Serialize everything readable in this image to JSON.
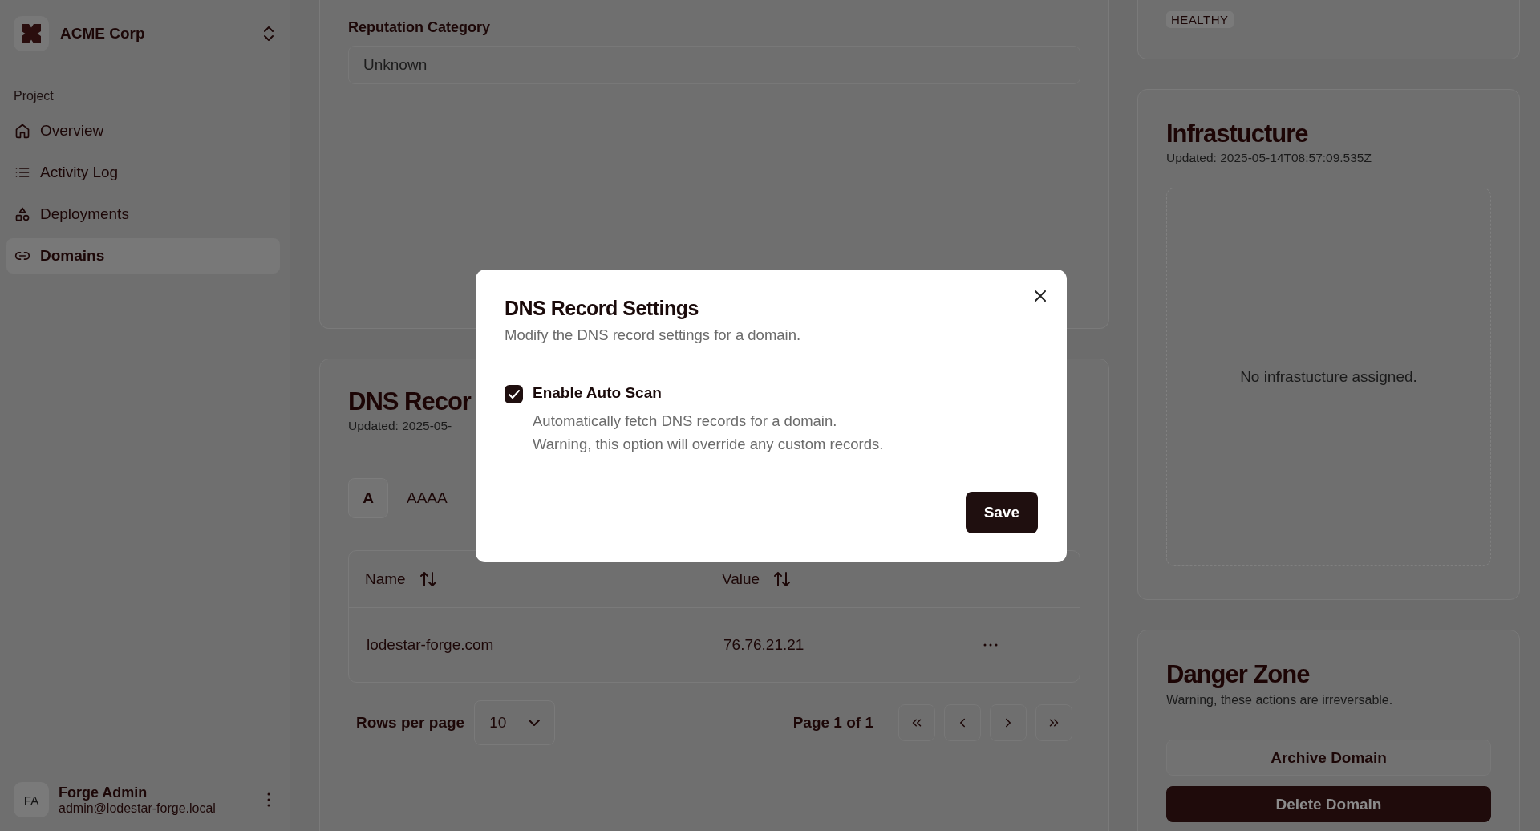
{
  "sidebar": {
    "org": {
      "name": "ACME Corp"
    },
    "group_label": "Project",
    "items": [
      {
        "label": "Overview",
        "selected": false
      },
      {
        "label": "Activity Log",
        "selected": false
      },
      {
        "label": "Deployments",
        "selected": false
      },
      {
        "label": "Domains",
        "selected": true
      }
    ],
    "user": {
      "initials": "FA",
      "name": "Forge Admin",
      "email": "admin@lodestar-forge.local"
    }
  },
  "main": {
    "reputation": {
      "label": "Reputation Category",
      "value": "Unknown"
    },
    "dns_card": {
      "title": "DNS Recor",
      "updated": "Updated: 2025-05-",
      "record_tabs": [
        {
          "label": "A",
          "selected": true
        },
        {
          "label": "AAAA",
          "selected": false
        }
      ],
      "table": {
        "columns": [
          "Name",
          "Value"
        ],
        "rows": [
          {
            "name": "lodestar-forge.com",
            "value": "76.76.21.21"
          }
        ]
      },
      "pagination": {
        "rows_label": "Rows per page",
        "rows_value": "10",
        "page_label": "Page 1 of 1"
      }
    }
  },
  "right": {
    "status_badge": "HEALTHY",
    "infrastructure": {
      "title": "Infrastucture",
      "updated": "Updated: 2025-05-14T08:57:09.535Z",
      "empty": "No infrastucture assigned."
    },
    "danger": {
      "title": "Danger Zone",
      "subtitle": "Warning, these actions are irreversable.",
      "buttons": [
        {
          "label": "Archive Domain",
          "kind": "outline"
        },
        {
          "label": "Delete Domain",
          "kind": "destructive"
        }
      ]
    }
  },
  "dialog": {
    "title": "DNS Record Settings",
    "description": "Modify the DNS record settings for a domain.",
    "option": {
      "label": "Enable Auto Scan",
      "checked": true,
      "help": [
        "Automatically fetch DNS records for a domain.",
        "Warning, this option will override any custom records."
      ]
    },
    "buttons": [
      "Save"
    ]
  }
}
